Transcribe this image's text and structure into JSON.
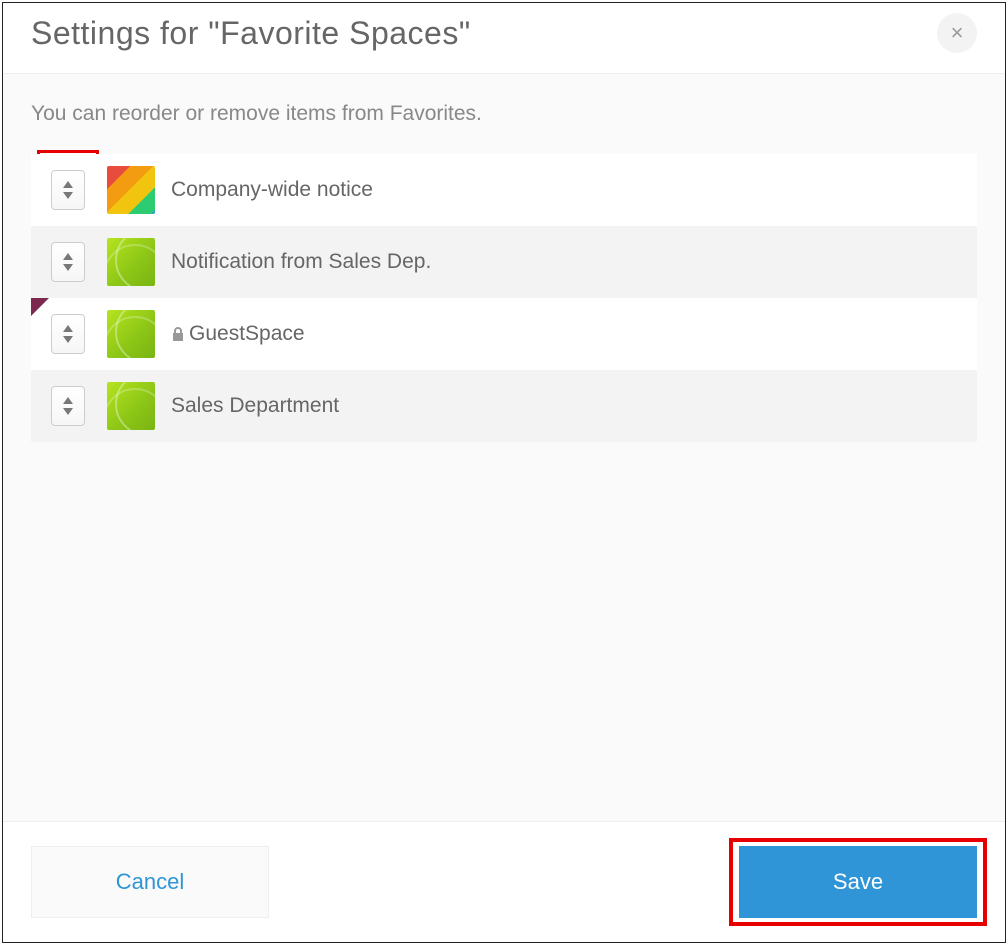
{
  "dialog": {
    "title": "Settings for \"Favorite Spaces\"",
    "close_glyph": "×",
    "instruction": "You can reorder or remove items from Favorites."
  },
  "items": [
    {
      "label": "Company-wide notice",
      "icon": "pencils",
      "locked": false,
      "flag": false
    },
    {
      "label": "Notification from Sales Dep.",
      "icon": "green",
      "locked": false,
      "flag": false
    },
    {
      "label": "GuestSpace",
      "icon": "green",
      "locked": true,
      "flag": true
    },
    {
      "label": "Sales Department",
      "icon": "green",
      "locked": false,
      "flag": false
    }
  ],
  "footer": {
    "cancel": "Cancel",
    "save": "Save"
  },
  "highlights": {
    "first_drag_handle": true,
    "save_button": true
  },
  "colors": {
    "primary": "#2f95d6",
    "highlight": "#e60000"
  }
}
